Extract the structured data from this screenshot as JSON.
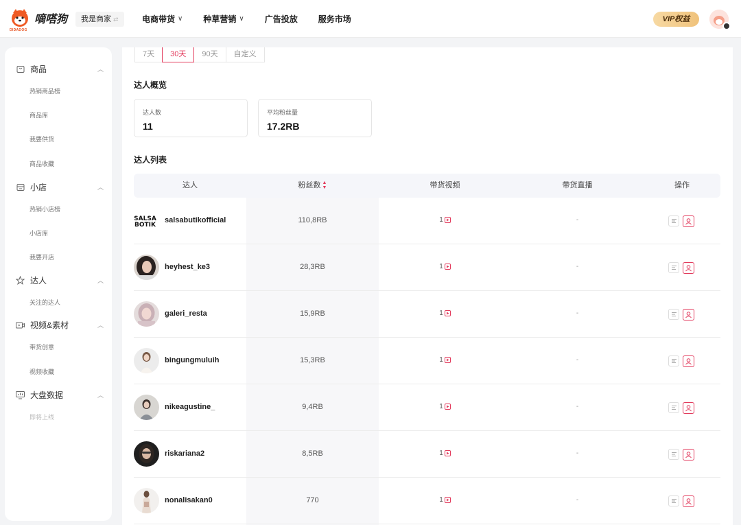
{
  "header": {
    "logo_text": "嘀嗒狗",
    "logo_sub": "DIDADOG",
    "merchant_label": "我是商家",
    "nav": [
      {
        "label": "电商带货",
        "has_dropdown": true
      },
      {
        "label": "种草营销",
        "has_dropdown": true
      },
      {
        "label": "广告投放",
        "has_dropdown": false
      },
      {
        "label": "服务市场",
        "has_dropdown": false
      }
    ],
    "vip_label": "VIP权益"
  },
  "sidebar": {
    "sections": [
      {
        "label": "商品",
        "icon": "bag-icon",
        "items": [
          "热销商品榜",
          "商品库",
          "我要供货",
          "商品收藏"
        ]
      },
      {
        "label": "小店",
        "icon": "shop-icon",
        "items": [
          "热销小店榜",
          "小店库",
          "我要开店"
        ]
      },
      {
        "label": "达人",
        "icon": "star-icon",
        "items": [
          "关注的达人"
        ]
      },
      {
        "label": "视频&素材",
        "icon": "video-icon",
        "items": [
          "带货创意",
          "视频收藏"
        ]
      },
      {
        "label": "大盘数据",
        "icon": "chart-icon",
        "items": [
          "即将上线"
        ]
      }
    ]
  },
  "main": {
    "tabs": [
      {
        "label": "7天",
        "active": false
      },
      {
        "label": "30天",
        "active": true
      },
      {
        "label": "90天",
        "active": false
      },
      {
        "label": "自定义",
        "active": false
      }
    ],
    "overview_title": "达人概览",
    "cards": [
      {
        "label": "达人数",
        "value": "11"
      },
      {
        "label": "平均粉丝量",
        "value": "17.2RB"
      }
    ],
    "list_title": "达人列表",
    "columns": [
      "达人",
      "粉丝数",
      "带货视频",
      "带货直播",
      "操作"
    ],
    "sorted_column": "粉丝数",
    "accent_color": "#e23a5c",
    "rows": [
      {
        "name": "salsabutikofficial",
        "fans": "110,8RB",
        "videos": "1",
        "live": "-"
      },
      {
        "name": "heyhest_ke3",
        "fans": "28,3RB",
        "videos": "1",
        "live": "-"
      },
      {
        "name": "galeri_resta",
        "fans": "15,9RB",
        "videos": "1",
        "live": "-"
      },
      {
        "name": "bingungmuluih",
        "fans": "15,3RB",
        "videos": "1",
        "live": "-"
      },
      {
        "name": "nikeagustine_",
        "fans": "9,4RB",
        "videos": "1",
        "live": "-"
      },
      {
        "name": "riskariana2",
        "fans": "8,5RB",
        "videos": "1",
        "live": "-"
      },
      {
        "name": "nonalisakan0",
        "fans": "770",
        "videos": "1",
        "live": "-"
      }
    ]
  }
}
